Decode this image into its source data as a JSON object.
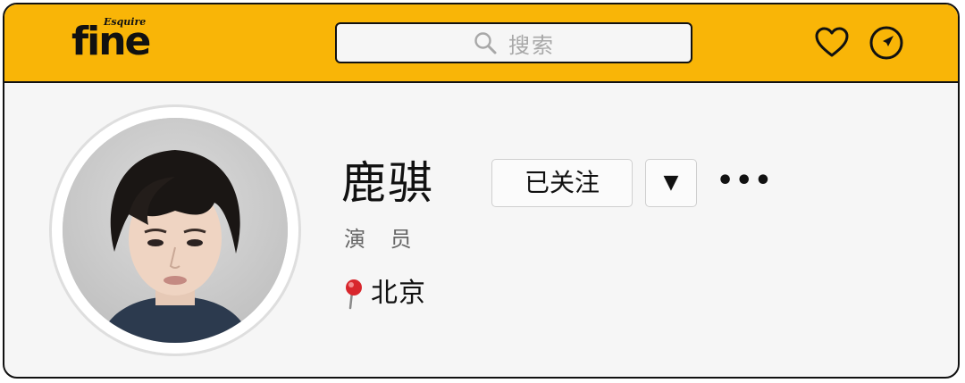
{
  "header": {
    "brand": "fine",
    "brand_sub": "Esquire",
    "search_placeholder": "搜索",
    "icons": [
      "heart-icon",
      "compass-icon",
      "search-icon"
    ],
    "accent_color": "#f9b507"
  },
  "profile": {
    "name": "鹿骐",
    "role": "演 员",
    "location": "北京",
    "follow_label": "已关注",
    "dropdown_label": "▼",
    "more_label": "•••"
  }
}
